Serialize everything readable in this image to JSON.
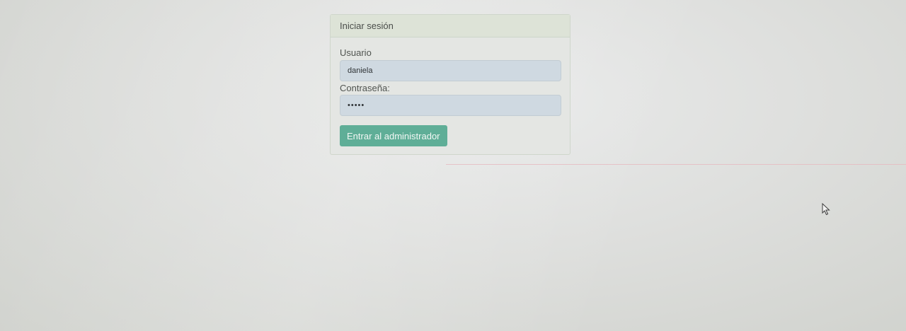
{
  "login_panel": {
    "title": "Iniciar sesión",
    "username_label": "Usuario",
    "username_value": "daniela",
    "password_label": "Contraseña:",
    "password_value": "•••••",
    "submit_label": "Entrar al administrador"
  },
  "colors": {
    "button_accent": "#5fae97",
    "input_background": "#cfd9e1",
    "heading_background": "#dde3d7"
  },
  "icons": {
    "cursor": "mouse-pointer-icon"
  }
}
